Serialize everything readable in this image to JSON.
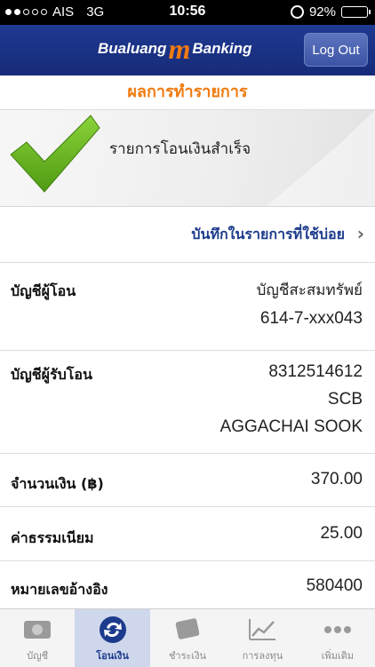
{
  "status_bar": {
    "carrier": "AIS",
    "network": "3G",
    "time": "10:56",
    "battery": "92%",
    "battery_level": 0.92
  },
  "header": {
    "logo_left": "Bualuang",
    "logo_m": "m",
    "logo_right": "Banking",
    "logout_label": "Log Out"
  },
  "result": {
    "title": "ผลการทำรายการ",
    "status": "รายการโอนเงินสำเร็จ"
  },
  "favorite_label": "บันทึกในรายการที่ใช้บ่อย",
  "details": {
    "from_label": "บัญชีผู้โอน",
    "from_name": "บัญชีสะสมทรัพย์",
    "from_number": "614-7-xxx043",
    "to_label": "บัญชีผู้รับโอน",
    "to_number": "8312514612",
    "to_bank": "SCB",
    "to_name": "AGGACHAI SOOK",
    "amount_label": "จำนวนเงิน (฿)",
    "amount": "370.00",
    "fee_label": "ค่าธรรมเนียม",
    "fee": "25.00",
    "ref_label": "หมายเลขอ้างอิง",
    "ref": "580400"
  },
  "tabs": [
    {
      "label": "บัญชี",
      "icon": "accounts-icon"
    },
    {
      "label": "โอนเงิน",
      "icon": "transfer-icon",
      "active": true
    },
    {
      "label": "ชำระเงิน",
      "icon": "payment-icon"
    },
    {
      "label": "การลงทุน",
      "icon": "investment-icon"
    },
    {
      "label": "เพิ่มเติม",
      "icon": "more-icon"
    }
  ],
  "colors": {
    "header_blue": "#1f3a92",
    "accent_orange": "#f07b10",
    "check_green": "#63b31a",
    "link_blue": "#1c3b8c"
  }
}
